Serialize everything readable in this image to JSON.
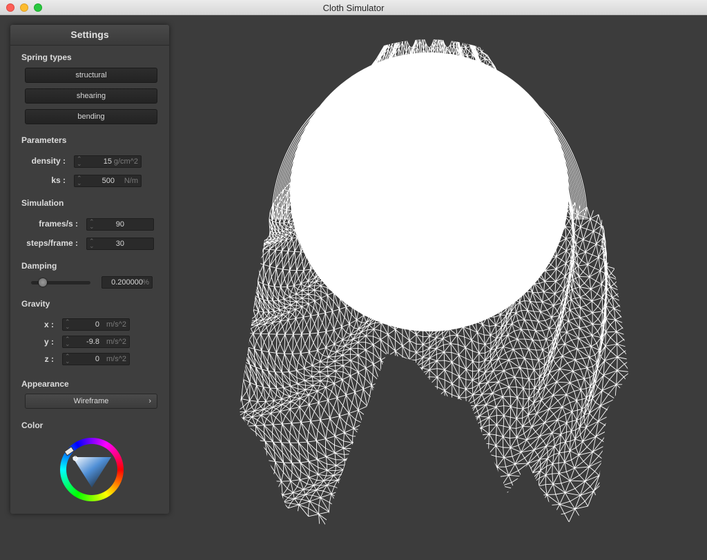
{
  "window": {
    "title": "Cloth Simulator"
  },
  "settings": {
    "header": "Settings",
    "spring_types": {
      "heading": "Spring types",
      "buttons": [
        "structural",
        "shearing",
        "bending"
      ]
    },
    "parameters": {
      "heading": "Parameters",
      "density": {
        "label": "density :",
        "value": "15",
        "unit": "g/cm^2"
      },
      "ks": {
        "label": "ks :",
        "value": "500",
        "unit": "N/m"
      }
    },
    "simulation": {
      "heading": "Simulation",
      "fps": {
        "label": "frames/s :",
        "value": "90"
      },
      "steps": {
        "label": "steps/frame :",
        "value": "30"
      }
    },
    "damping": {
      "heading": "Damping",
      "slider_fraction": 0.2,
      "value": "0.200000",
      "unit": "%"
    },
    "gravity": {
      "heading": "Gravity",
      "x": {
        "label": "x :",
        "value": "0",
        "unit": "m/s^2"
      },
      "y": {
        "label": "y :",
        "value": "-9.8",
        "unit": "m/s^2"
      },
      "z": {
        "label": "z :",
        "value": "0",
        "unit": "m/s^2"
      }
    },
    "appearance": {
      "heading": "Appearance",
      "selected": "Wireframe"
    },
    "color": {
      "heading": "Color",
      "selected_color": "#ffffff"
    }
  },
  "scene": {
    "background": "#3c3c3c",
    "mesh_color": "#ffffff",
    "render_mode": "Wireframe"
  }
}
